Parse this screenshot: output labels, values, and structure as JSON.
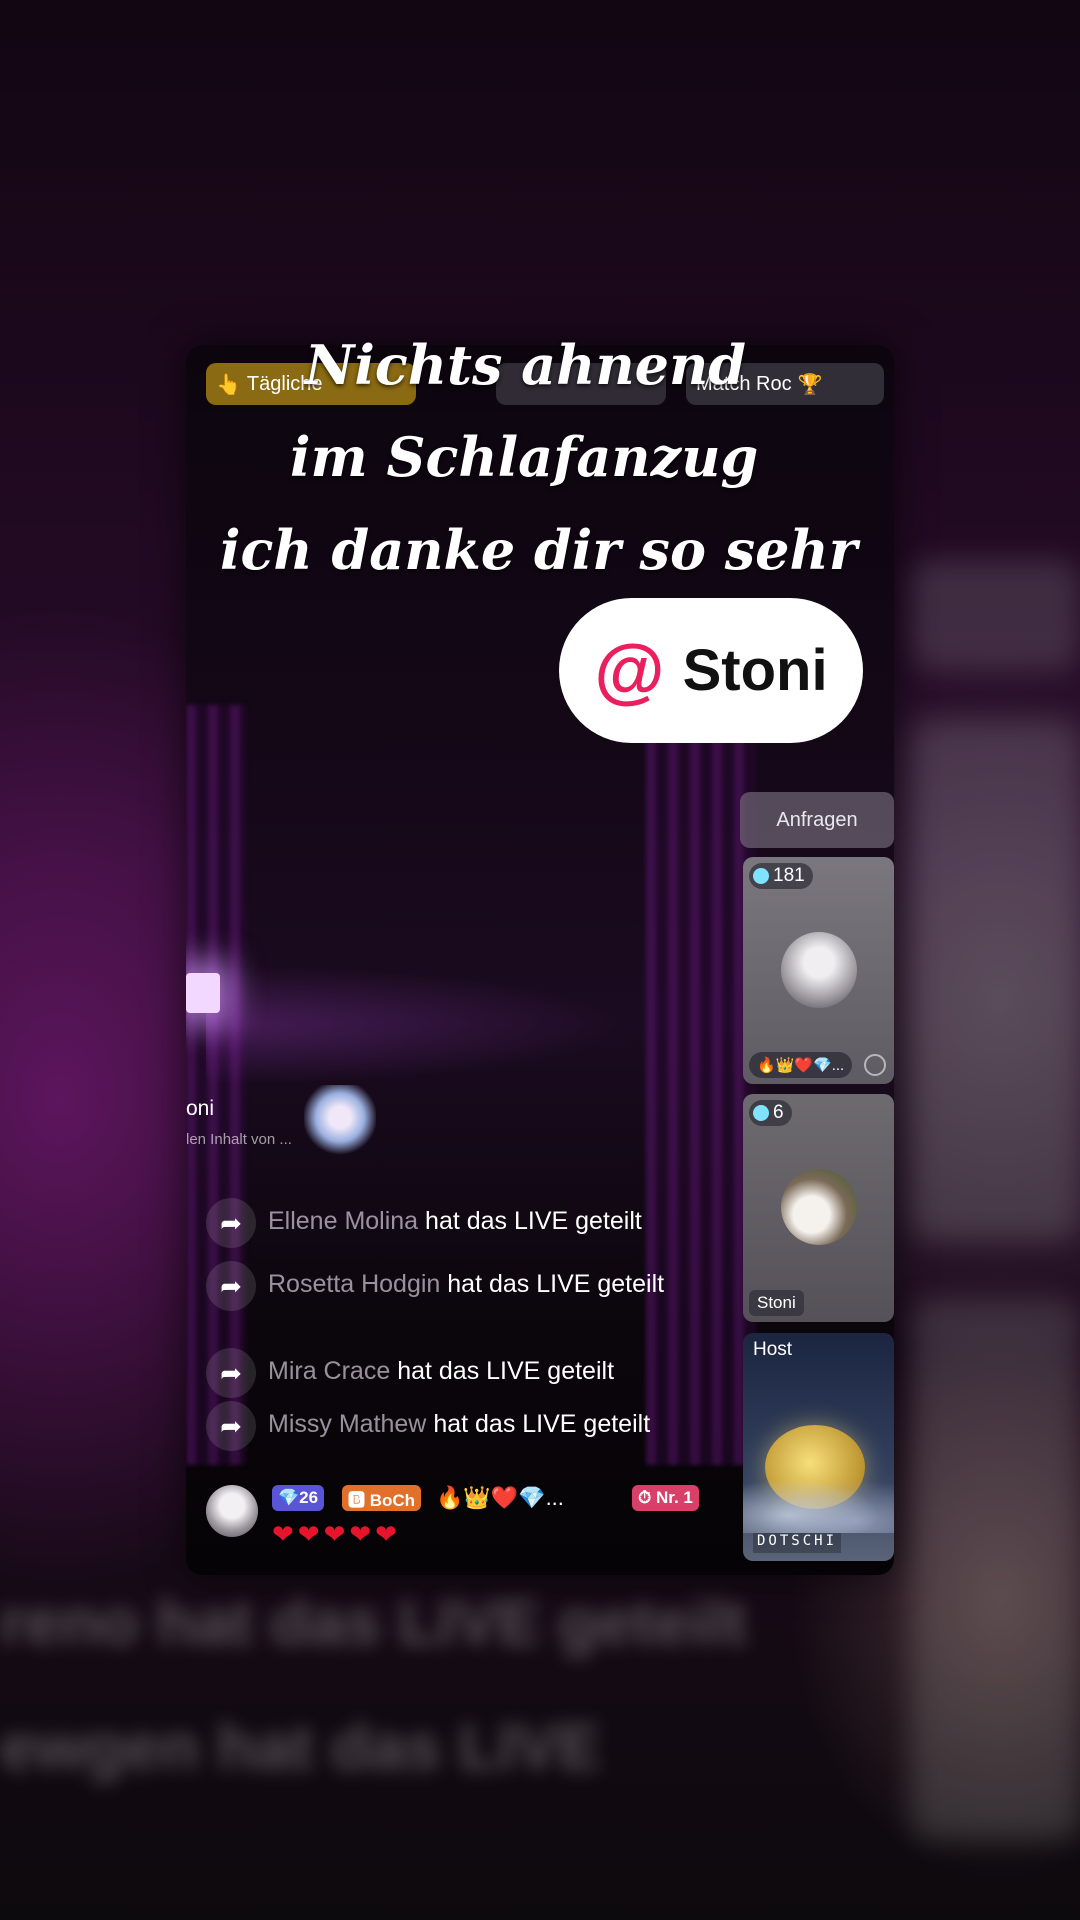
{
  "caption": {
    "line1": "Nichts ahnend",
    "line2": "im Schlafanzug",
    "line3": "ich danke dir so sehr"
  },
  "mention": {
    "at_symbol": "@",
    "name": "Stoni"
  },
  "top_bar": {
    "left_pill": "Tägliche",
    "right_pill": "Match Roc"
  },
  "requests_button": "Anfragen",
  "guests": [
    {
      "count": "181",
      "emojis": "🔥👑❤️💎..."
    },
    {
      "count": "6",
      "name": "Stoni"
    }
  ],
  "host": {
    "label": "Host",
    "name": "DOTSCHI"
  },
  "banner": {
    "title": "oni",
    "subtitle": "len Inhalt von ..."
  },
  "chat": [
    {
      "user": "Ellene Molina",
      "text": "hat das LIVE geteilt"
    },
    {
      "user": "Rosetta Hodgin",
      "text": "hat das LIVE geteilt"
    },
    {
      "user": "Mira Crace",
      "text": "hat das LIVE geteilt"
    },
    {
      "user": "Missy Mathew",
      "text": "hat das LIVE geteilt"
    }
  ],
  "bottom": {
    "gem_badge": "💎26",
    "name_badge": "🅱 BoCh",
    "emojis": "🔥👑❤️💎...",
    "rank_badge": "⏱ Nr. 1",
    "hearts": "❤❤❤❤❤"
  },
  "colors": {
    "mention_accent": "#ea1f5e",
    "heart": "#e8142c"
  }
}
